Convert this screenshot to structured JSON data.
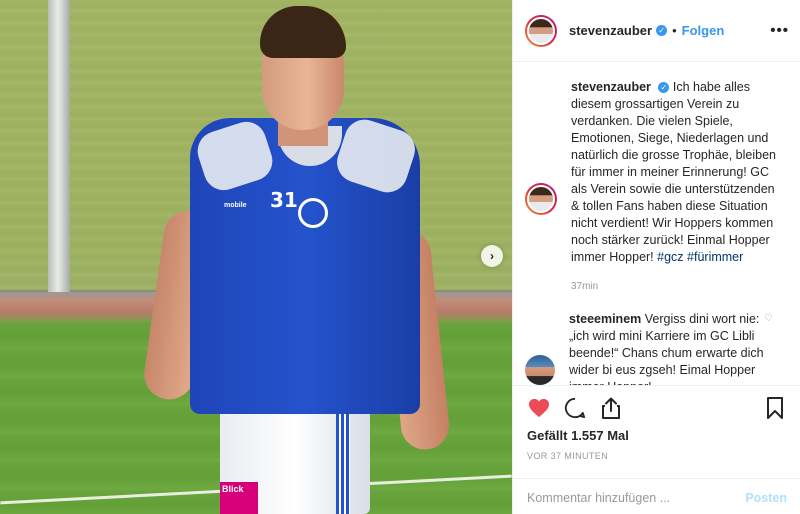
{
  "header": {
    "username": "stevenzauber",
    "separator": "•",
    "follow_label": "Folgen",
    "more_label": "•••"
  },
  "photo": {
    "jersey_number": "31",
    "sponsor_text": "mobile",
    "shorts_sponsor": "Blick"
  },
  "caption": {
    "username": "stevenzauber",
    "text": "Ich habe alles diesem grossartigen Verein zu verdanken. Die vielen Spiele, Emotionen, Siege, Niederlagen und natürlich die grosse Trophäe, bleiben für immer in meiner Erinnerung! GC als Verein sowie die unterstützenden & tollen Fans haben diese Situation nicht verdient! Wir Hoppers kommen noch stärker zurück! Einmal Hopper immer Hopper!",
    "hashtags": "#gcz #fürimmer",
    "time": "37min"
  },
  "comments": [
    {
      "username": "steeeminem",
      "text": "Vergiss dini wort nie: „ich wird mini Karriere im GC Libli beende!“ Chans chum erwarte dich wider bi eus zgseh! Eimal Hopper immer Hopper!"
    }
  ],
  "actions": {
    "likes": "Gefällt 1.557 Mal",
    "posted_ago": "VOR 37 MINUTEN"
  },
  "add_comment": {
    "placeholder": "Kommentar hinzufügen ...",
    "post_label": "Posten"
  },
  "icons": {
    "like": "heart-icon",
    "comment": "comment-icon",
    "share": "share-icon",
    "save": "bookmark-icon",
    "next": "chevron-right-icon"
  },
  "colors": {
    "like_active": "#ed4956",
    "link_blue": "#3897f0",
    "hashtag": "#003569",
    "muted": "#999999"
  }
}
